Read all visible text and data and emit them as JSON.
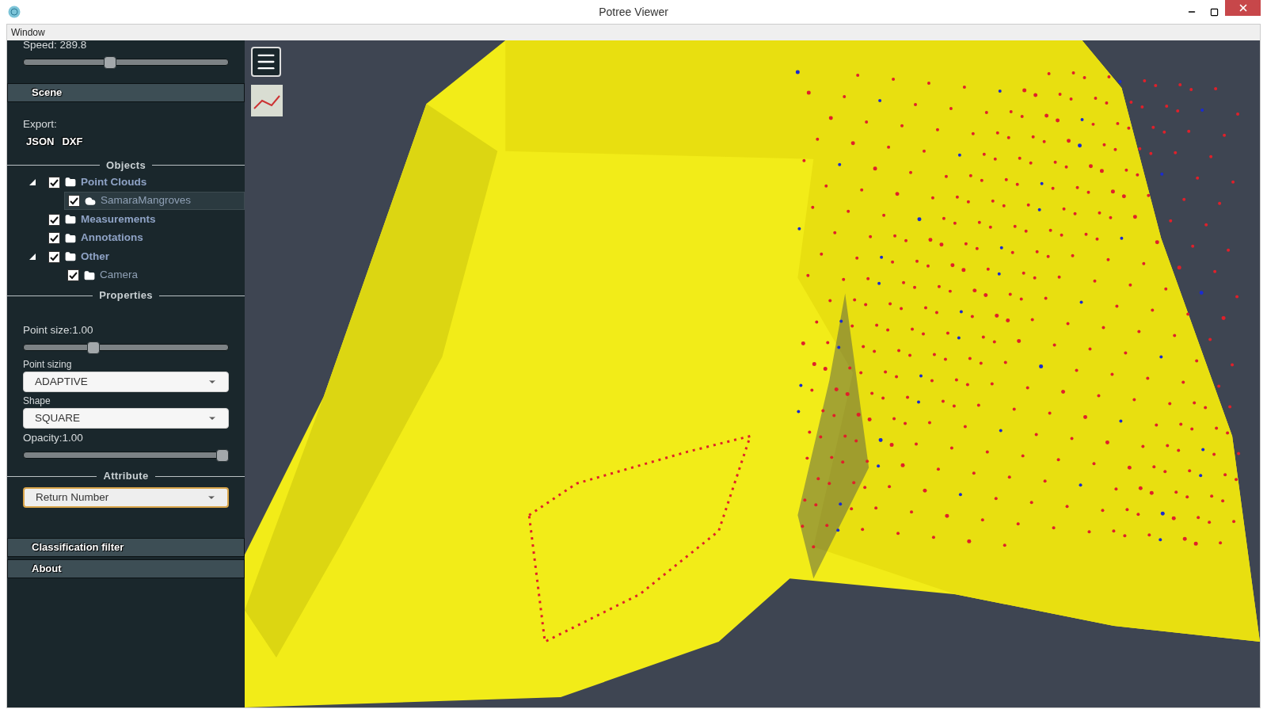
{
  "window": {
    "title": "Potree Viewer"
  },
  "menu_bar": [
    "Window"
  ],
  "sidebar": {
    "speed_slider": {
      "label": "Speed: 289.8",
      "level": 0.42
    },
    "scene_header": "Scene",
    "export": {
      "label": "Export:",
      "buttons": [
        "JSON",
        "DXF"
      ]
    },
    "objects": {
      "title": "Objects",
      "tree": [
        {
          "label": "Point Clouds",
          "kind": "folder",
          "checked": true,
          "expanded": true,
          "selected": false,
          "children": [
            {
              "label": "SamaraMangroves",
              "kind": "cloud",
              "checked": true,
              "selected": true
            }
          ]
        },
        {
          "label": "Measurements",
          "kind": "folder",
          "checked": true,
          "selected": false
        },
        {
          "label": "Annotations",
          "kind": "folder",
          "checked": true,
          "selected": false
        },
        {
          "label": "Other",
          "kind": "folder",
          "checked": true,
          "expanded": true,
          "selected": false,
          "children": [
            {
              "label": "Camera",
              "kind": "folder",
              "checked": true,
              "selected": false
            }
          ]
        }
      ]
    },
    "properties": {
      "title": "Properties",
      "controls": [
        {
          "kind": "slider",
          "label": "Point size:1.00",
          "level": 0.33
        },
        {
          "kind": "select",
          "label": "Point sizing",
          "value": "ADAPTIVE"
        },
        {
          "kind": "select",
          "label": "Shape",
          "value": "SQUARE"
        },
        {
          "kind": "slider",
          "label": "Opacity:1.00",
          "level": 1
        }
      ]
    },
    "attribute": {
      "title": "Attribute",
      "value": "Return Number",
      "focused": true
    },
    "collapsed_sections": [
      "Classification filter",
      "About"
    ]
  }
}
